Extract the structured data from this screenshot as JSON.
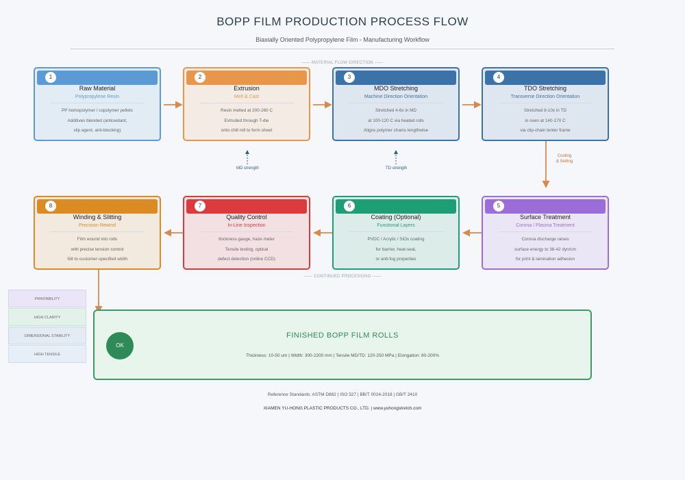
{
  "header": {
    "title": "BOPP FILM PRODUCTION PROCESS FLOW",
    "subtitle": "Biaxially Oriented Polypropylene Film - Manufacturing Workflow"
  },
  "sections": {
    "top": "—— MATERIAL FLOW DIRECTION ——",
    "bottom": "—— CONTINUED PROCESSING ——"
  },
  "colors": {
    "blue": "#5b9bd5",
    "orange": "#e8964a",
    "steel": "#3b72a8",
    "purple": "#9b6dd6",
    "green": "#1e9e74",
    "red": "#dd3b3b",
    "amber": "#dc8a22",
    "arrow": "#d9894a"
  },
  "steps": [
    {
      "num": "1",
      "name": "Raw Material",
      "sub": "Polypropylene Resin",
      "desc": [
        "PP homopolymer / copolymer pellets",
        "Additives blended (antioxidant,",
        "slip agent, anti-blocking)"
      ],
      "color": "#5b9bd5"
    },
    {
      "num": "2",
      "name": "Extrusion",
      "sub": "Melt & Cast",
      "desc": [
        "Resin melted at 200-260 C",
        "Extruded through T-die",
        "onto chill roll to form sheet"
      ],
      "color": "#e8964a"
    },
    {
      "num": "3",
      "name": "MDO Stretching",
      "sub": "Machine Direction Orientation",
      "desc": [
        "Stretched 4-6x in MD",
        "at 100-120 C via heated rolls",
        "Aligns polymer chains lengthwise"
      ],
      "color": "#3b72a8"
    },
    {
      "num": "4",
      "name": "TDO Stretching",
      "sub": "Transverse Direction Orientation",
      "desc": [
        "Stretched 8-10x in TD",
        "in oven at 140-170 C",
        "via clip-chain tenter frame"
      ],
      "color": "#3b72a8"
    },
    {
      "num": "5",
      "name": "Surface Treatment",
      "sub": "Corona / Plasma Treatment",
      "desc": [
        "Corona discharge raises",
        "surface energy to 38-42 dyn/cm",
        "for print & lamination adhesion"
      ],
      "color": "#9b6dd6"
    },
    {
      "num": "6",
      "name": "Coating (Optional)",
      "sub": "Functional Layers",
      "desc": [
        "PVDC / Acrylic / SiOx coating",
        "for barrier, heat-seal,",
        "or anti-fog properties"
      ],
      "color": "#1e9e74"
    },
    {
      "num": "7",
      "name": "Quality Control",
      "sub": "In-Line Inspection",
      "desc": [
        "thickness gauge, haze meter",
        "Tensile testing, optical",
        "defect detection (online CCD)"
      ],
      "color": "#dd3b3b"
    },
    {
      "num": "8",
      "name": "Winding & Slitting",
      "sub": "Precision Rewind",
      "desc": [
        "Film wound into rolls",
        "with precise tension control",
        "Slit to customer-specified width"
      ],
      "color": "#dc8a22"
    }
  ],
  "notes": {
    "md": "MD strength",
    "td": "TD strength",
    "cooling": [
      "Cooling",
      "& Setting"
    ]
  },
  "legend": [
    "PRINTABILITY",
    "HIGH CLARITY",
    "DIMENSIONAL STABILITY",
    "HIGH TENSILE"
  ],
  "final": {
    "badge": "OK",
    "title": "FINISHED BOPP FILM ROLLS",
    "specs": "Thickness: 10-50 um  |  Width: 300-2200 mm  |  Tensile MD/TD: 120-250 MPa  |  Elongation: 80-200%"
  },
  "footer": {
    "standards": "Reference Standards: ASTM D882  |  ISO 527  |  BB/T 0024-2018  |  GB/T 2410",
    "company": "XIAMEN YU-HONG PLASTIC PRODUCTS CO., LTD.  |  www.yuhongstretch.com"
  }
}
